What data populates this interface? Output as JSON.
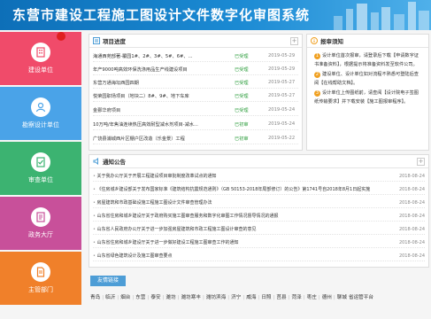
{
  "header": {
    "title": "东营市建设工程施工图设计文件数字化审图系统"
  },
  "sidebar": {
    "items": [
      {
        "label": "建设单位",
        "color": "#f04b6a",
        "icon": "building-icon"
      },
      {
        "label": "勘察设计单位",
        "color": "#4aa3e8",
        "icon": "user-icon"
      },
      {
        "label": "审查单位",
        "color": "#3cb371",
        "icon": "checklist-icon"
      },
      {
        "label": "政务大厅",
        "color": "#c8509a",
        "icon": "document-icon"
      },
      {
        "label": "主管部门",
        "color": "#f0802a",
        "icon": "file-icon"
      }
    ]
  },
  "project_panel": {
    "title": "项目进度",
    "rows": [
      {
        "name": "海通西苑部著-覆园1#、2#、3#、5#、6#、...",
        "status": "已受理",
        "date": "2019-05-29"
      },
      {
        "name": "年产9000吨高效环保洗涤用品生产线建设项目",
        "status": "已受理",
        "date": "2019-05-29"
      },
      {
        "name": "东营万通海坛西园四期",
        "status": "已受理",
        "date": "2019-05-27"
      },
      {
        "name": "悦荣园职场项目（地块二）8#、9#、地下车库",
        "status": "已受理",
        "date": "2019-05-27"
      },
      {
        "name": "金鄞华府项目",
        "status": "已受理",
        "date": "2019-05-24"
      },
      {
        "name": "10万吨/年焦油连续热压高效耐型减水剂项目-减水...",
        "status": "已初审",
        "date": "2019-05-24"
      },
      {
        "name": "广饶县浦城西片区棚户区改造（乐金景）工程",
        "status": "已初审",
        "date": "2019-05-22"
      }
    ]
  },
  "guide_panel": {
    "title": "报审须知",
    "items": [
      {
        "num": "1",
        "text": "设计单位首次报审，请登录后下载【申请数字证书准备资料】，根据提示将准备资料发至软件公司。"
      },
      {
        "num": "2",
        "text": "建设单位、设计单位如对流程不熟悉可登陆后查阅【在线帮助文档】。"
      },
      {
        "num": "3",
        "text": "设计单位上传图纸前，请查阅【设计院电子签图纸传输要求】并下载安装【施工图报审程序】。"
      }
    ]
  },
  "notice_panel": {
    "title": "通知公告",
    "rows": [
      {
        "text": "关于我办公厅关于开展工程建设项目审批制度改革试点的通知",
        "date": "2018-08-24"
      },
      {
        "text": "《住房城乡建设部关于发布国家标准《建筑结构抗震规范通则》（GB 50153-2018年局部修订）的公告》第1741号自2018年8月1日起实施",
        "date": "2018-08-24"
      },
      {
        "text": "房屋建筑和市政基础设施工程施工图设计文件审查管理办法",
        "date": "2018-08-24"
      },
      {
        "text": "山东省住房和城乡建设厅关于政府购买施工图审查服务和数字化审图工作情况督导情况的通报",
        "date": "2018-08-24"
      },
      {
        "text": "山东省人民政府办公厅关于进一步加强房屋建筑和市政工程施工图设计审查的意见",
        "date": "2018-08-24"
      },
      {
        "text": "山东省住房和城乡建设厅关于进一步做好建设工程施工图审查工作的通知",
        "date": "2018-08-24"
      },
      {
        "text": "山东省绿色建筑设计及施工图审查要点",
        "date": "2018-08-24"
      }
    ]
  },
  "friendly_links": {
    "title": "友情链接",
    "items": [
      "青岛",
      "临沂",
      "烟台",
      "东营",
      "泰安",
      "潍坊",
      "潍坊寒丰",
      "潍坊滨海",
      "济宁",
      "威海",
      "日照",
      "莒县",
      "菏泽",
      "枣庄",
      "德州",
      "聊城",
      "省运管平台"
    ]
  }
}
